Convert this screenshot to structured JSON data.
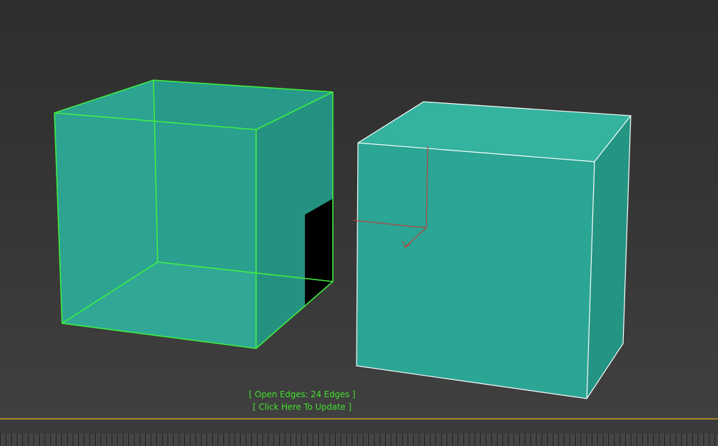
{
  "viewport": {
    "status": {
      "open_edges": "[ Open Edges: 24 Edges ]",
      "update_link": "[ Click Here To Update ]"
    }
  },
  "colors": {
    "box_fill": "#2aa592",
    "selection_wire": "#3ff03f",
    "object_wire": "#ffffff",
    "status_text": "#43e12e",
    "timeline_border": "#a88a2a"
  },
  "icons": [
    "transform-gizmo-icon"
  ]
}
